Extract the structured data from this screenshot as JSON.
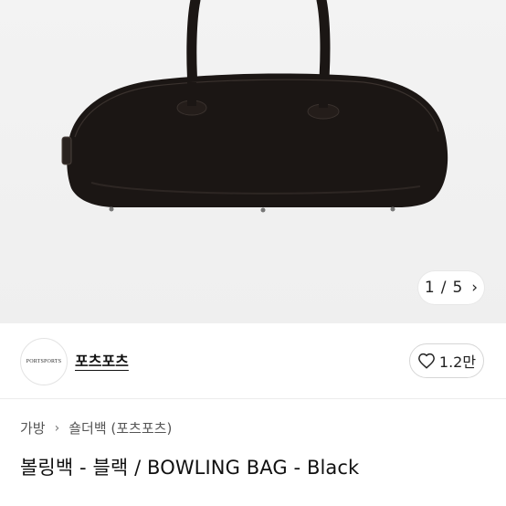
{
  "gallery": {
    "image_alt_icon": "handbag-image",
    "current": "1",
    "separator": "/",
    "total": "5",
    "next_icon": "chevron-right-icon"
  },
  "seller": {
    "logo_text": "PORTSPORTS",
    "name": "포츠포츠"
  },
  "like": {
    "icon": "heart-outline-icon",
    "count": "1.2만"
  },
  "breadcrumb": {
    "items": [
      "가방",
      "숄더백 (포츠포츠)"
    ],
    "separator_icon": "chevron-right-icon"
  },
  "product": {
    "title": "볼링백 - 블랙 / BOWLING BAG - Black"
  },
  "colors": {
    "gallery_bg": "#f1f1f1",
    "bag": "#1b1614"
  }
}
